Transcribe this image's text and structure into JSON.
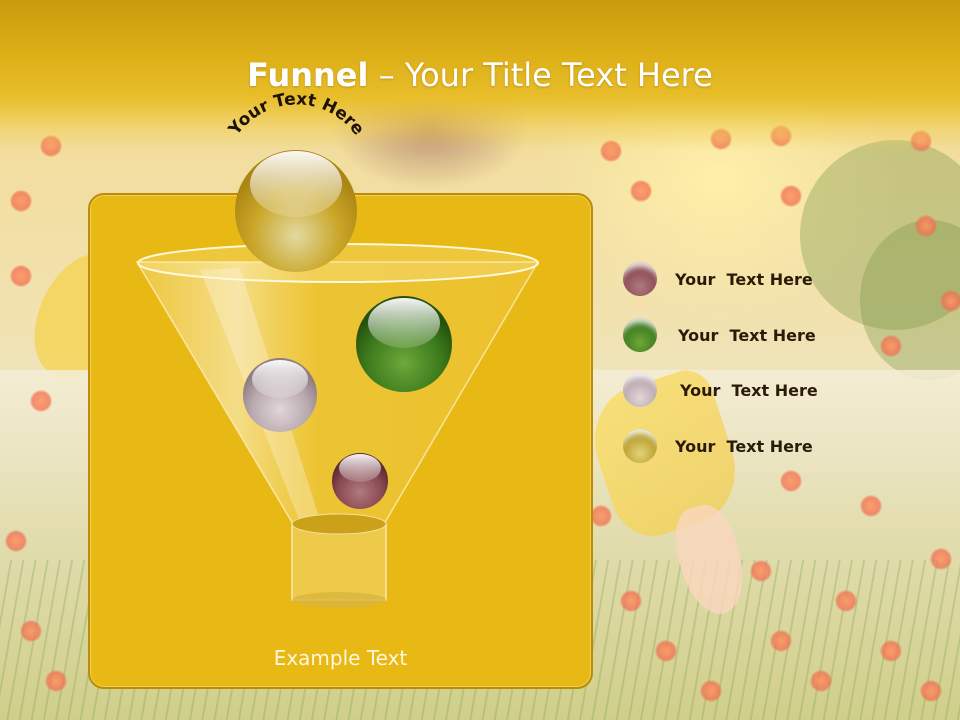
{
  "slide": {
    "title_bold": "Funnel",
    "title_rest": " – Your Title Text Here"
  },
  "funnel": {
    "arc_text": "Your Text Here",
    "bottom_label": "Example Text"
  },
  "legend": [
    {
      "label": "Your  Text Here",
      "color": "#8a4a52"
    },
    {
      "label": "Your  Text Here",
      "color": "#3c7a1c"
    },
    {
      "label": "Your  Text Here",
      "color": "#b7a8ad"
    },
    {
      "label": "Your  Text Here",
      "color": "#b8a02c"
    }
  ],
  "colors": {
    "title_band": "#dcae16",
    "panel": "#e8b814",
    "title_text": "#ffffff"
  }
}
